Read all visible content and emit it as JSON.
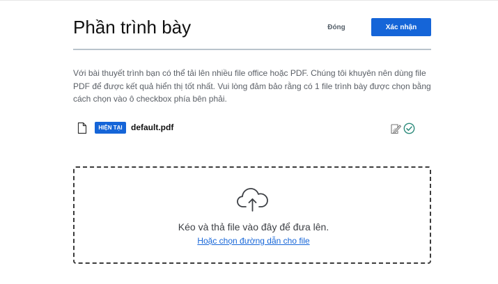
{
  "dialog": {
    "title": "Phần trình bày",
    "close_label": "Đóng",
    "confirm_label": "Xác nhận",
    "description": "Với bài thuyết trình bạn có thể tải lên nhiều file office hoặc PDF. Chúng tôi khuyên nên dùng file PDF để được kết quả hiển thị tốt nhất. Vui lòng đảm bảo rằng có 1 file trình bày được chọn bằng cách chọn vào ô checkbox phía bên phải."
  },
  "files": [
    {
      "badge": "HIỆN TẠI",
      "name": "default.pdf",
      "icons": [
        "file-icon",
        "edit-icon",
        "check-circle-icon"
      ]
    }
  ],
  "dropzone": {
    "icon": "cloud-upload-icon",
    "text": "Kéo và thả file vào đây để đưa lên.",
    "link": "Hoặc chọn đường dẫn cho file"
  },
  "colors": {
    "accent": "#1565d8",
    "check": "#2b8a7a",
    "divider": "#b9c3cc",
    "dropzone_border": "#3b3b3b"
  }
}
